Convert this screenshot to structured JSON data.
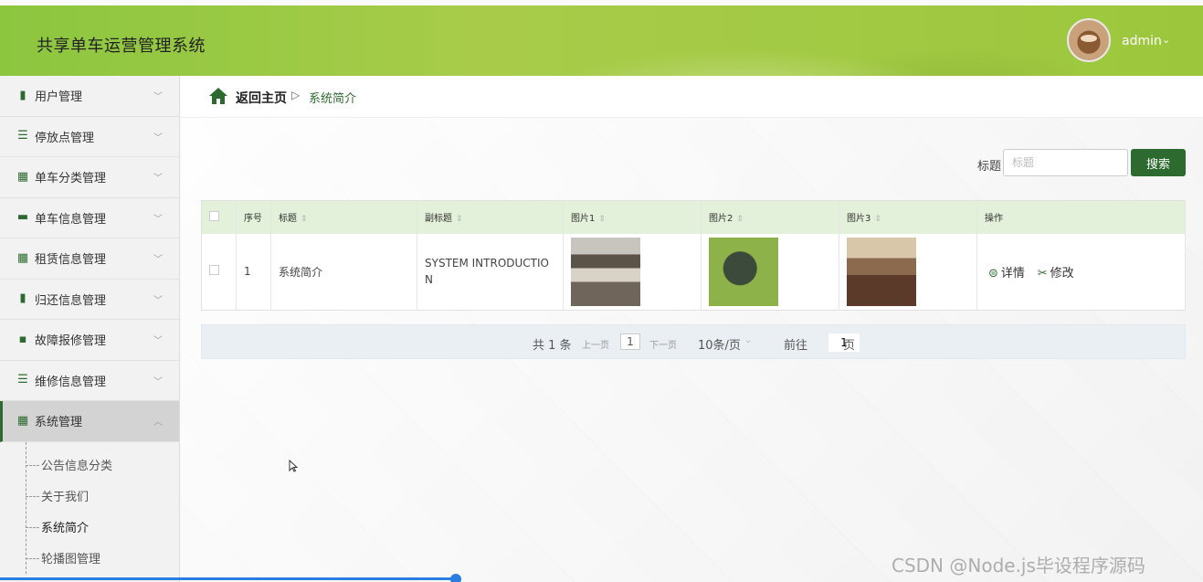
{
  "header": {
    "app_title": "共享单车运营管理系统",
    "user_name": "admin",
    "user_caret": "⌄"
  },
  "sidebar": {
    "items": [
      {
        "label": "用户管理",
        "icon": "ledger-icon"
      },
      {
        "label": "停放点管理",
        "icon": "sliders-icon"
      },
      {
        "label": "单车分类管理",
        "icon": "grid-icon"
      },
      {
        "label": "单车信息管理",
        "icon": "briefcase-icon"
      },
      {
        "label": "租赁信息管理",
        "icon": "grid-icon"
      },
      {
        "label": "归还信息管理",
        "icon": "bar-chart-icon"
      },
      {
        "label": "故障报修管理",
        "icon": "chat-icon"
      },
      {
        "label": "维修信息管理",
        "icon": "list-icon"
      },
      {
        "label": "系统管理",
        "icon": "grid-icon",
        "active": true
      }
    ],
    "sub_items": [
      {
        "label": "公告信息分类"
      },
      {
        "label": "关于我们"
      },
      {
        "label": "系统简介",
        "current": true
      },
      {
        "label": "轮播图管理"
      }
    ]
  },
  "breadcrumb": {
    "home": "返回主页",
    "separator": "▷",
    "current": "系统简介"
  },
  "search": {
    "label": "标题",
    "placeholder": "标题",
    "value": "",
    "button": "搜索"
  },
  "table": {
    "columns": [
      "",
      "序号",
      "标题",
      "副标题",
      "图片1",
      "图片2",
      "图片3",
      "操作"
    ],
    "sortable": [
      false,
      false,
      true,
      true,
      true,
      true,
      true,
      false
    ],
    "sort_glyph": "⇕",
    "rows": [
      {
        "index": "1",
        "title": "系统简介",
        "subtitle": "SYSTEM INTRODUCTIO N",
        "actions": {
          "detail": "详情",
          "edit": "修改"
        }
      }
    ]
  },
  "pager": {
    "total": "共 1 条",
    "prev": "上一页",
    "current_page": "1",
    "next": "下一页",
    "page_size": "10条/页",
    "page_size_caret": "⌄",
    "goto_label": "前往",
    "goto_value": "1",
    "goto_suffix": "页"
  },
  "watermark": "CSDN @Node.js毕设程序源码",
  "colors": {
    "accent": "#2d6a2f",
    "header_green": "#9cc73c",
    "table_header": "#e4f1da"
  }
}
